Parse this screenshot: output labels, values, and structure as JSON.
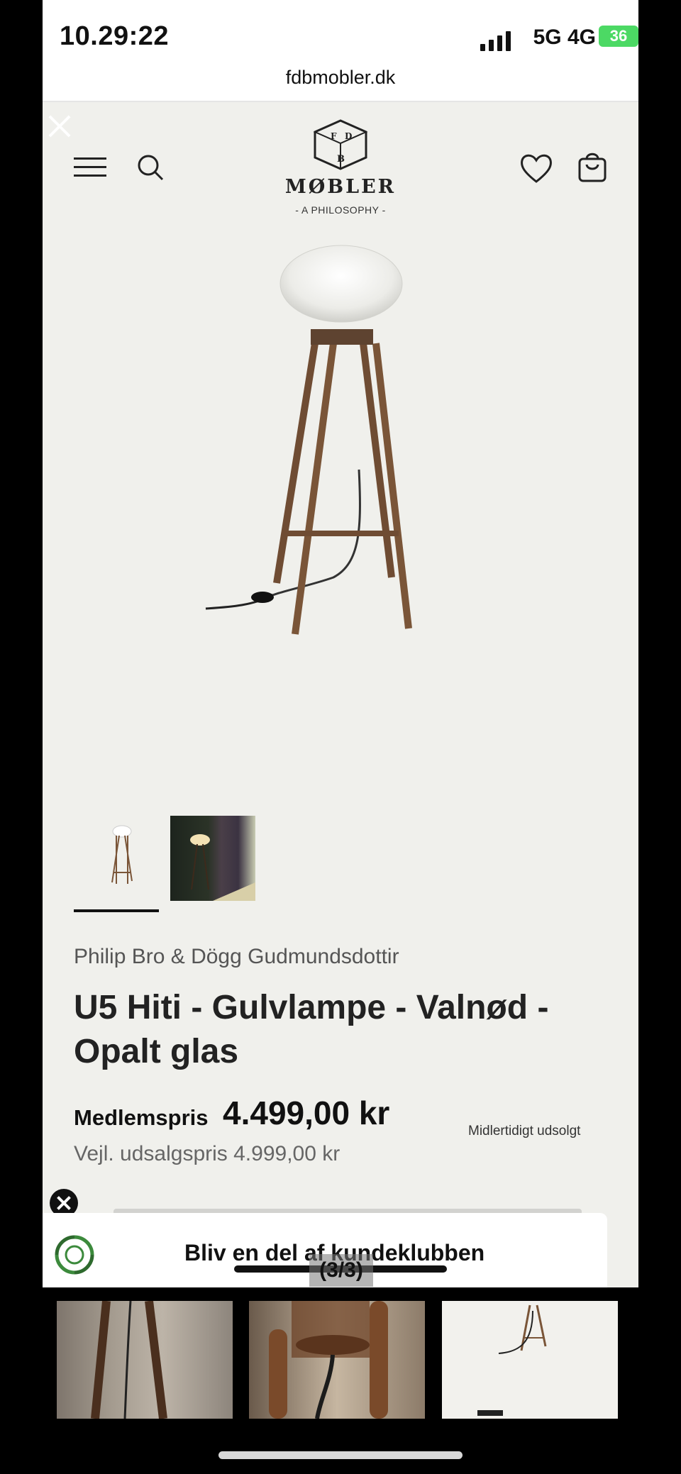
{
  "status_bar": {
    "time": "10.29:22",
    "network": "5G 4G",
    "battery": "36"
  },
  "browser": {
    "url": "fdbmobler.dk"
  },
  "header": {
    "logo_name": "MØBLER",
    "logo_tagline": "- A PHILOSOPHY -",
    "icons": [
      "menu-icon",
      "search-icon",
      "heart-icon",
      "bag-icon"
    ]
  },
  "product": {
    "designer": "Philip Bro & Dögg Gudmundsdottir",
    "title": "U5 Hiti - Gulvlampe - Valnød - Opalt glas",
    "member_price_label": "Medlemspris",
    "member_price": "4.499,00 kr",
    "availability": "Midlertidigt udsolgt",
    "rrp": "Vejl. udsalgspris 4.999,00 kr"
  },
  "banner": {
    "text": "Bliv en del af kundeklubben"
  },
  "gallery": {
    "counter": "(3/3)",
    "selected_index": 3
  },
  "colors": {
    "page_bg": "#f0f0ec",
    "text": "#222222",
    "battery": "#4cd964"
  }
}
